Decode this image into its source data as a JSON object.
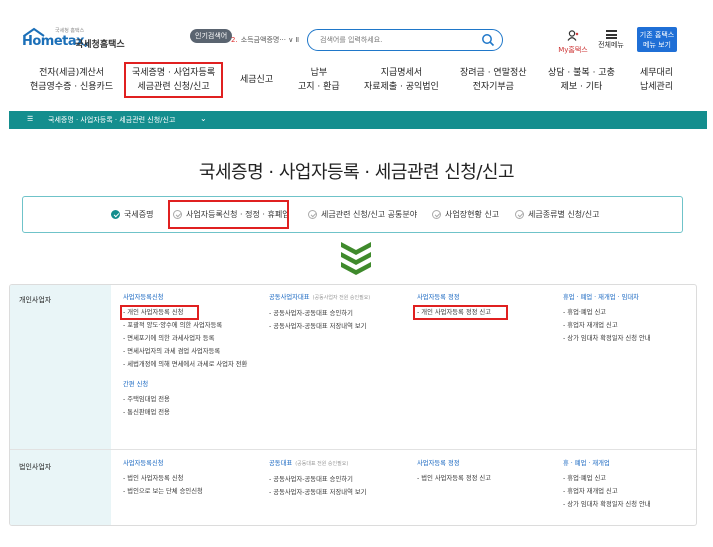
{
  "header": {
    "logo_small": "국세청 홈택스",
    "logo_text": "Hometax,",
    "org_name": "국세청홈택스",
    "popular_badge": "인기검색어",
    "popular_item": {
      "rank": "2.",
      "text": "소득금액증명···"
    },
    "search_placeholder": "검색어를 입력하세요.",
    "my_label": "My홈택스",
    "menu_label": "전체메뉴",
    "basic_menu_button": [
      "기존 홈택스",
      "메뉴 보기"
    ]
  },
  "nav": {
    "items": [
      {
        "line1": "전자(세금)계산서",
        "line2": "현금영수증 · 신용카드"
      },
      {
        "line1": "국세증명 · 사업자등록",
        "line2": "세금관련 신청/신고"
      },
      {
        "line1": "세금신고",
        "line2": ""
      },
      {
        "line1": "납부",
        "line2": "고지 · 환급"
      },
      {
        "line1": "지급명세서",
        "line2": "자료제출 · 공익법인"
      },
      {
        "line1": "장려금 · 연말정산",
        "line2": "전자기부금"
      },
      {
        "line1": "상담 · 불복 · 고충",
        "line2": "제보 · 기타"
      },
      {
        "line1": "세무대리",
        "line2": "납세관리"
      }
    ]
  },
  "breadcrumb": {
    "menu_glyph": "☰",
    "text": "국세증명 · 사업자등록 · 세금관련 신청/신고"
  },
  "page_title": "국세증명 · 사업자등록 · 세금관련 신청/신고",
  "tabs": [
    {
      "label": "국세증명",
      "checked": true
    },
    {
      "label": "사업자등록신청 · 정정 · 휴폐업",
      "checked": false
    },
    {
      "label": "세금관련 신청/신고 공통분야",
      "checked": false
    },
    {
      "label": "사업장현황 신고",
      "checked": false
    },
    {
      "label": "세금종류별 신청/신고",
      "checked": false
    }
  ],
  "table": {
    "personal": {
      "label": "개인사업자",
      "col1": {
        "header": "사업자등록신청",
        "items": [
          "- 개인 사업자등록 신청",
          "- 포괄적 양도·양수에 의한 사업자등록",
          "- 면세포기에 의한 과세사업자 등록",
          "- 면세사업자의 과세 겸업 사업자등록",
          "- 세법개정에 의해 면세에서 과세로 사업자 전환"
        ],
        "sub_header": "간편 신청",
        "sub_items": [
          "- 주택임대업 전용",
          "- 통신판매업 전용"
        ]
      },
      "col2": {
        "header": "공동사업자대표",
        "header_note": "(공동사업자 전원 승인필요)",
        "items": [
          "- 공동사업자-공동대표 승인하기",
          "- 공동사업자-공동대표 저장내역 보기"
        ]
      },
      "col3": {
        "header": "사업자등록 정정",
        "items": [
          "- 개인 사업자등록 정정 신고"
        ]
      },
      "col4": {
        "header": "휴업 · 폐업 · 재개업 · 임대차",
        "items": [
          "- 휴업·폐업 신고",
          "- 휴업자 재개업 신고",
          "- 상가 임대차 확정일자 신청 안내"
        ]
      }
    },
    "corporate": {
      "label": "법인사업자",
      "col1": {
        "header": "사업자등록신청",
        "items": [
          "- 법인 사업자등록 신청",
          "- 법인으로 보는 단체 승인신청"
        ]
      },
      "col2": {
        "header": "공동대표",
        "header_note": "(공동대표 전원 승인필요)",
        "items": [
          "- 공동사업자-공동대표 승인하기",
          "- 공동사업자-공동대표 저장내역 보기"
        ]
      },
      "col3": {
        "header": "사업자등록 정정",
        "items": [
          "- 법인 사업자등록 정정 신고"
        ]
      },
      "col4": {
        "header": "휴 · 폐업 · 재개업",
        "items": [
          "- 휴업·폐업 신고",
          "- 휴업자 재개업 신고",
          "- 상가 임대차 확정일자 신청 안내"
        ]
      }
    }
  },
  "colors": {
    "teal": "#148e8e",
    "blue_link": "#1565c0",
    "highlight_red": "#e02020",
    "brand_blue": "#1f6fd6"
  }
}
